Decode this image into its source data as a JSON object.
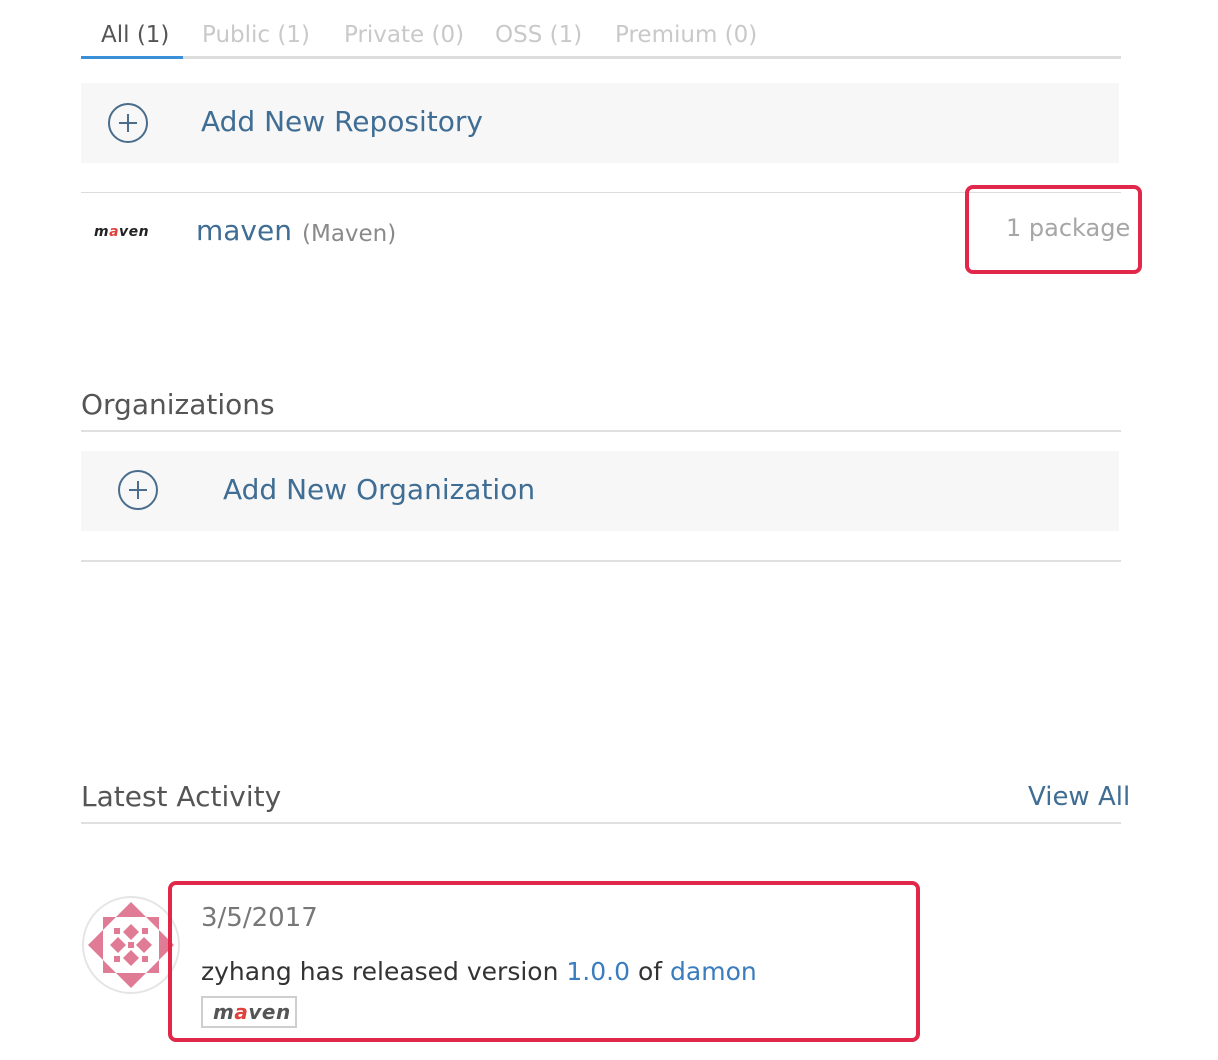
{
  "tabs": [
    {
      "label": "All (1)",
      "active": true
    },
    {
      "label": "Public (1)",
      "active": false
    },
    {
      "label": "Private (0)",
      "active": false
    },
    {
      "label": "OSS (1)",
      "active": false
    },
    {
      "label": "Premium (0)",
      "active": false
    }
  ],
  "repositories": {
    "add_label": "Add New Repository",
    "items": [
      {
        "logo_text": "maven",
        "name": "maven",
        "type": "(Maven)",
        "package_count": "1 package"
      }
    ]
  },
  "organizations": {
    "title": "Organizations",
    "add_label": "Add New Organization"
  },
  "activity": {
    "title": "Latest Activity",
    "view_all_label": "View All",
    "items": [
      {
        "date": "3/5/2017",
        "user": "zyhang",
        "text_prefix": "has released version",
        "version": "1.0.0",
        "text_mid": "of",
        "package": "damon",
        "badge_text": "maven"
      }
    ]
  },
  "colors": {
    "accent": "#3a90d8",
    "link": "#3f6d94",
    "highlight_border": "#e2284a",
    "maven_a": "#e0413d",
    "avatar_pattern": "#e07b96"
  },
  "icons": {
    "add_repository": "plus-circle-icon",
    "add_organization": "plus-circle-icon",
    "avatar": "identicon-avatar"
  }
}
